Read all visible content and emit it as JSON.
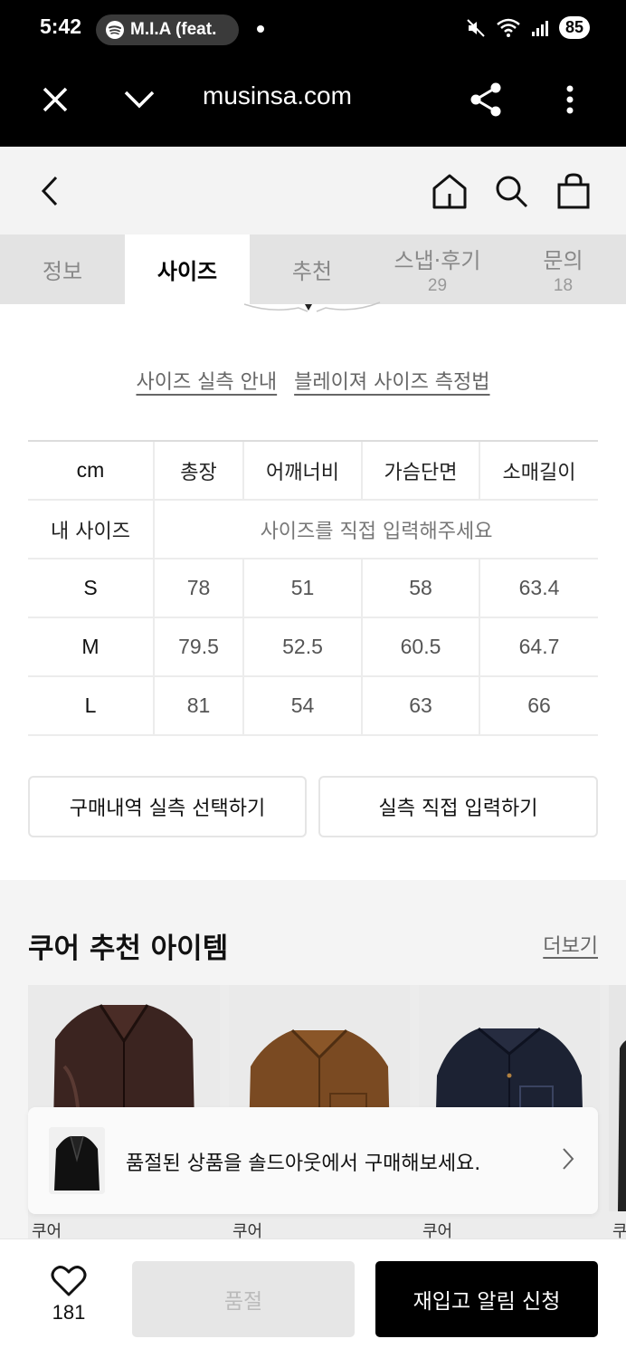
{
  "status_bar": {
    "time": "5:42",
    "media_text": "M.I.A (feat.",
    "battery": "85"
  },
  "browser": {
    "url": "musinsa.com"
  },
  "tabs": [
    {
      "label": "정보",
      "count": ""
    },
    {
      "label": "사이즈",
      "count": ""
    },
    {
      "label": "추천",
      "count": ""
    },
    {
      "label": "스냅·후기",
      "count": "29"
    },
    {
      "label": "문의",
      "count": "18"
    }
  ],
  "size_links": {
    "guide": "사이즈 실측 안내",
    "measure": "블레이져 사이즈 측정법"
  },
  "size_table": {
    "headers": [
      "cm",
      "총장",
      "어깨너비",
      "가슴단면",
      "소매길이"
    ],
    "my_size_label": "내 사이즈",
    "my_size_placeholder": "사이즈를 직접 입력해주세요",
    "rows": [
      {
        "size": "S",
        "values": [
          "78",
          "51",
          "58",
          "63.4"
        ]
      },
      {
        "size": "M",
        "values": [
          "79.5",
          "52.5",
          "60.5",
          "64.7"
        ]
      },
      {
        "size": "L",
        "values": [
          "81",
          "54",
          "63",
          "66"
        ]
      }
    ]
  },
  "actions": {
    "select_purchase": "구매내역 실측 선택하기",
    "direct_input": "실측 직접 입력하기"
  },
  "recommend": {
    "title": "쿠어 추천 아이템",
    "more": "더보기",
    "product_labels": [
      "쿠어",
      "쿠어",
      "쿠어",
      "쿠"
    ]
  },
  "soldout_banner": {
    "text": "품절된 상품을 솔드아웃에서 구매해보세요."
  },
  "bottom_bar": {
    "like_count": "181",
    "soldout_label": "품절",
    "notify_label": "재입고 알림 신청"
  },
  "colors": {
    "accent": "#000000",
    "status_bar_bg": "#000000",
    "header_bg": "#f3f3f3"
  }
}
